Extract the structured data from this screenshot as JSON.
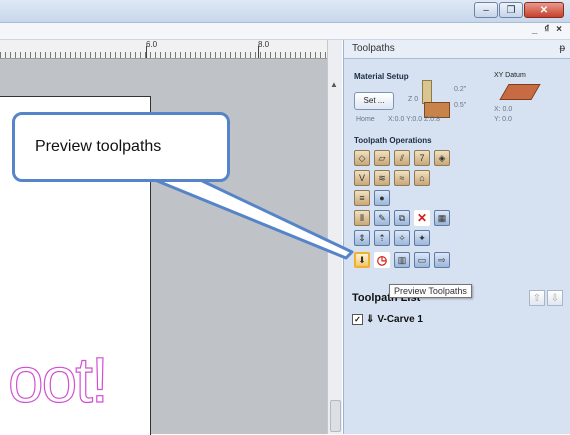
{
  "window": {
    "minimize_icon": "minimize-icon",
    "restore_icon": "restore-icon",
    "close_icon": "close-icon"
  },
  "mdi": {
    "controls": "_ ₫ ×"
  },
  "ruler": {
    "label1": "6.0",
    "label2": "8.0"
  },
  "canvas": {
    "text": "oot!"
  },
  "panel": {
    "title": "Toolpaths",
    "pin": "ᵽ",
    "material": {
      "title": "Material Setup",
      "set_button": "Set ...",
      "z_label": "Z 0",
      "z_top": "0.2\"",
      "z_thick": "0.5\"",
      "home_label": "Home",
      "home_coords": "X:0.0 Y:0.0 Z:0.8"
    },
    "xy_datum": {
      "title": "XY Datum",
      "x": "X: 0.0",
      "y": "Y: 0.0"
    },
    "operations_title": "Toolpath Operations",
    "tooltip": "Preview Toolpaths",
    "list_title": "Toolpath List",
    "list_items": [
      {
        "label": "V-Carve 1",
        "checked": "✓"
      }
    ]
  },
  "callout": {
    "text": "Preview toolpaths"
  },
  "colors": {
    "accent": "#5684c9",
    "carve_outline": "#d24fd2"
  }
}
